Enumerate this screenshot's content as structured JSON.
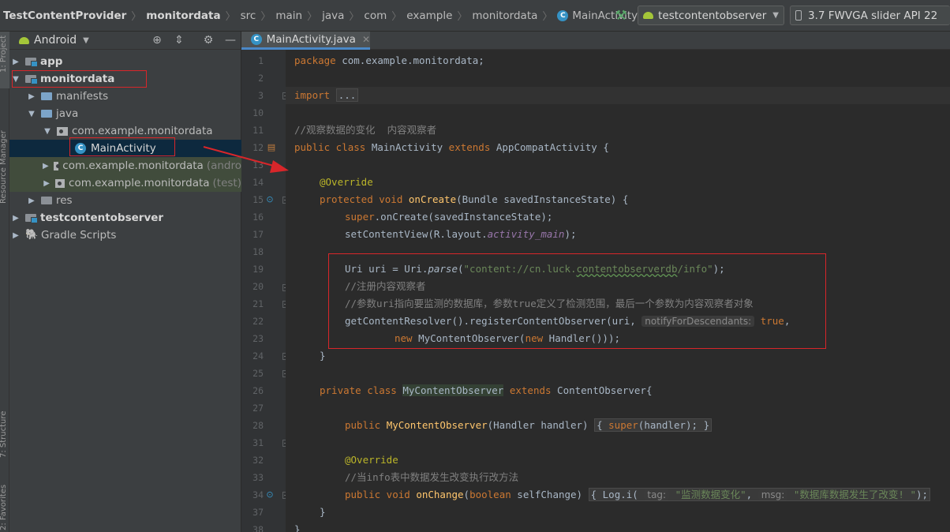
{
  "breadcrumbs": [
    "TestContentProvider",
    "monitordata",
    "src",
    "main",
    "java",
    "com",
    "example",
    "monitordata",
    "MainActivity"
  ],
  "toolbar": {
    "run_config": "testcontentobserver",
    "device": "3.7  FWVGA slider API 22"
  },
  "left_stripe": {
    "project": "1: Project",
    "resource_manager": "Resource Manager",
    "structure": "7: Structure",
    "favorites": "2: Favorites"
  },
  "project_panel": {
    "view_mode": "Android",
    "tree": [
      {
        "label": "app",
        "bold": true
      },
      {
        "label": "monitordata",
        "bold": true
      },
      {
        "label": "manifests"
      },
      {
        "label": "java"
      },
      {
        "label": "com.example.monitordata"
      },
      {
        "label": "MainActivity"
      },
      {
        "label": "com.example.monitordata",
        "suffix": "(andro"
      },
      {
        "label": "com.example.monitordata",
        "suffix": "(test)"
      },
      {
        "label": "res"
      },
      {
        "label": "testcontentobserver",
        "bold": true
      },
      {
        "label": "Gradle Scripts"
      }
    ]
  },
  "editor": {
    "tab": "MainActivity.java",
    "line_numbers": [
      "1",
      "2",
      "3",
      "10",
      "11",
      "12",
      "13",
      "14",
      "15",
      "16",
      "17",
      "18",
      "19",
      "20",
      "21",
      "22",
      "23",
      "24",
      "25",
      "26",
      "27",
      "28",
      "31",
      "32",
      "33",
      "34",
      "37",
      "38"
    ],
    "code": {
      "package_kw": "package",
      "package_name": " com.example.monitordata;",
      "import_kw": "import",
      "import_fold": "...",
      "comment1": "//观察数据的变化  内容观察者",
      "class_mods": "public class",
      "class_name": " MainActivity ",
      "extends_kw": "extends",
      "class_tail": " AppCompatActivity {",
      "override": "@Override",
      "protected_void": "protected void",
      "oncreate": "onCreate",
      "oncreate_args": "(Bundle savedInstanceState) {",
      "super_kw": "super",
      "super_call": ".onCreate(savedInstanceState);",
      "setcontent_a": "setContentView(R.layout.",
      "setcontent_field": "activity_main",
      "setcontent_b": ");",
      "uri_a": "Uri uri = Uri.",
      "uri_parse": "parse",
      "uri_b": "(",
      "uri_str_a": "\"content://cn.luck.",
      "uri_str_b": "contentobserverdb",
      "uri_str_c": "/info\"",
      "uri_c": ");",
      "comment2": "//注册内容观察者",
      "comment3": "//参数uri指向要监测的数据库，参数true定义了检测范围，最后一个参数为内容观察者对象",
      "register_a": "getContentResolver().registerContentObserver(uri, ",
      "register_hint": "notifyForDescendants:",
      "register_true": "true",
      "register_b": ",",
      "new_kw": "new",
      "new_obs": " MyContentObserver(",
      "new_kw2": "new",
      "new_handler": " Handler()));",
      "brace_close": "}",
      "private_class": "private class",
      "inner_class": "MyContentObserver",
      "extends_kw2": "extends",
      "inner_tail": " ContentObserver{",
      "public_kw": "public",
      "ctor_name": "MyContentObserver",
      "ctor_args": "(Handler handler) ",
      "ctor_fold_open": "{ ",
      "ctor_super": "super",
      "ctor_body": "(handler); }",
      "override2": "@Override",
      "comment4": "//当info表中数据发生改变执行改方法",
      "public_void": "public void",
      "onchange": "onChange",
      "onchange_args_a": "(",
      "boolean_kw": "boolean",
      "onchange_args_b": " selfChange) ",
      "log_fold": "{ Log.i(",
      "tag_hint": "tag:",
      "tag_str": "\"监测数据变化\"",
      "msg_sep": ", ",
      "msg_hint": "msg:",
      "msg_str": "\"数据库数据发生了改变! \"",
      "log_end": ");",
      "brace_close2": "}",
      "brace_close3": "}"
    }
  },
  "colors": {
    "annotation_red": "#d8262a",
    "selection": "#0d293e",
    "accent_blue": "#4a88c7"
  }
}
